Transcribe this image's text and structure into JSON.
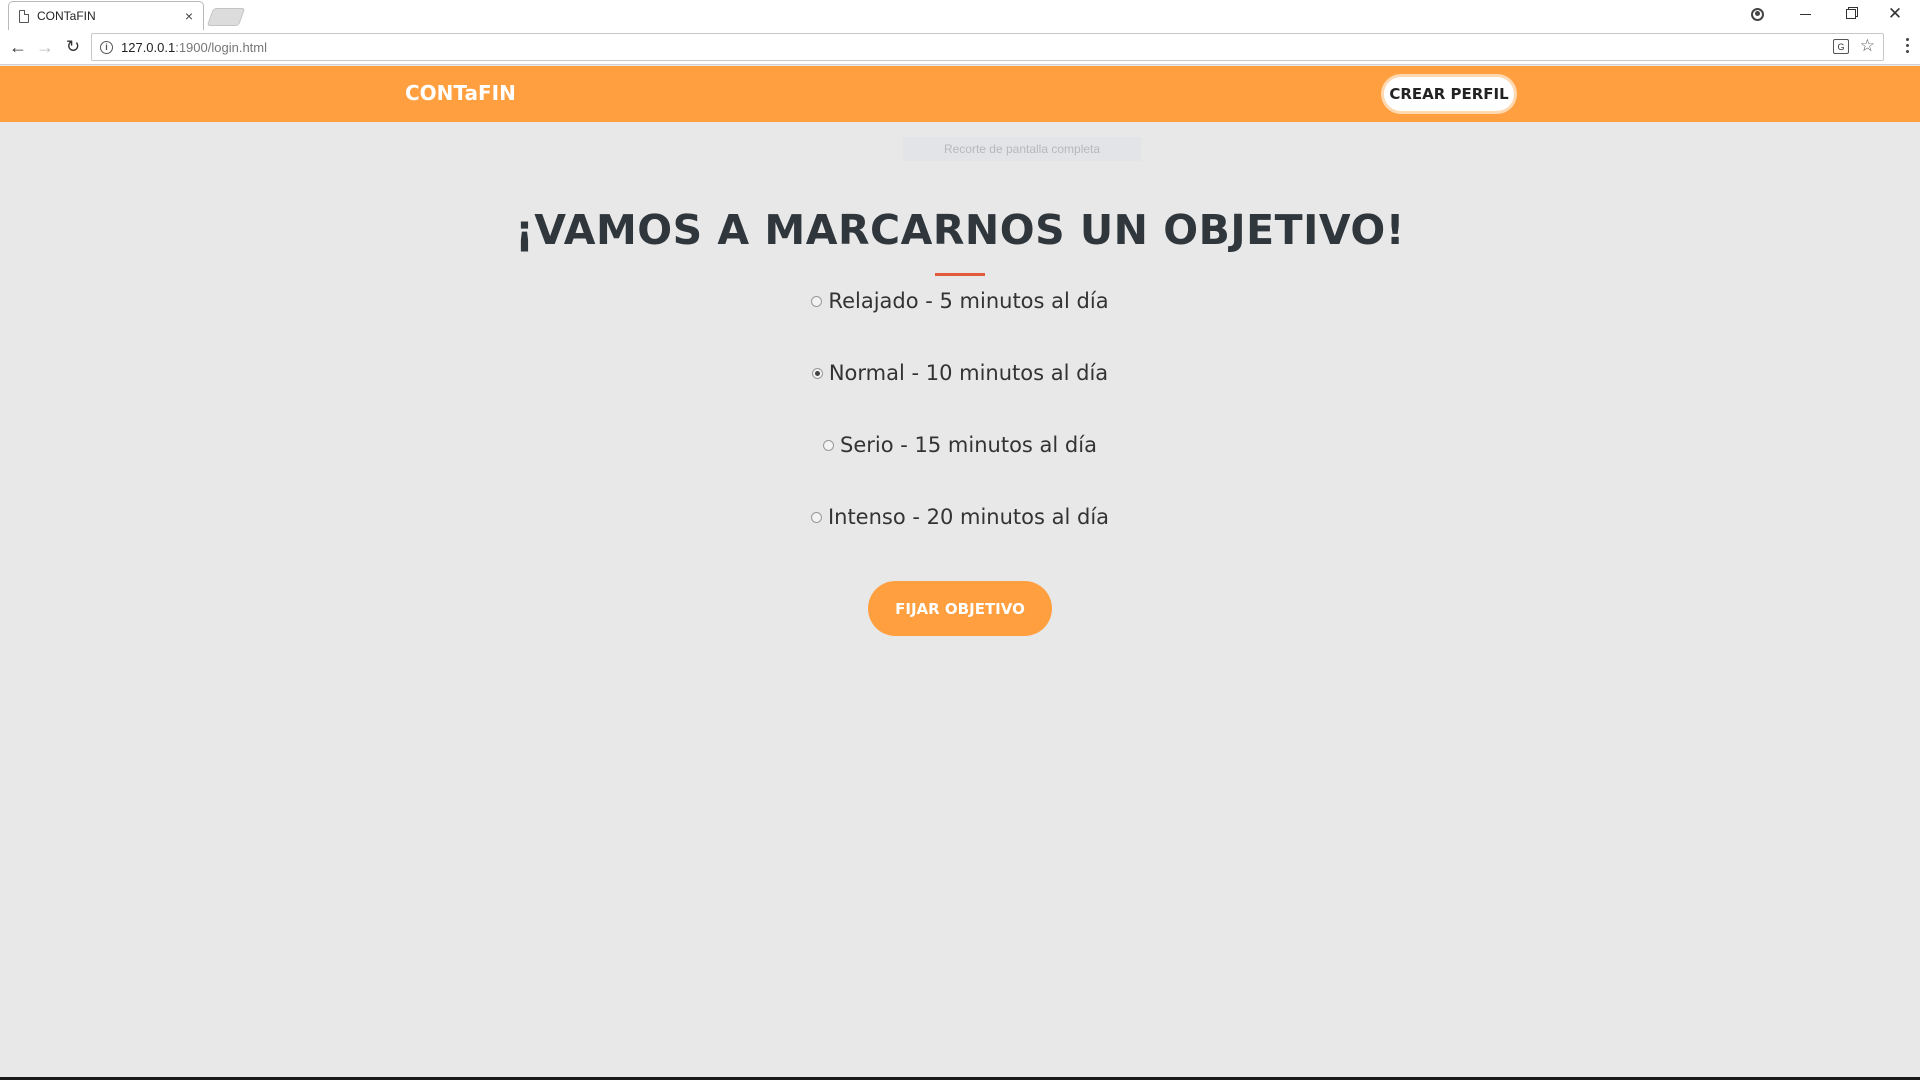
{
  "browser": {
    "tab_title": "CONTaFIN",
    "tab_close": "×",
    "url_host": "127.0.0.1",
    "url_rest": ":1900/login.html",
    "close_glyph": "✕"
  },
  "navbar": {
    "brand": "CONTaFIN",
    "crear_perfil": "CREAR PERFIL"
  },
  "snip_overlay": "Recorte de pantalla completa",
  "main": {
    "heading": "¡VAMOS A MARCARNOS UN OBJETIVO!",
    "options": [
      {
        "label": "Relajado - 5 minutos al día",
        "checked": false
      },
      {
        "label": "Normal - 10 minutos al día",
        "checked": true
      },
      {
        "label": "Serio - 15 minutos al día",
        "checked": false
      },
      {
        "label": "Intenso - 20 minutos al día",
        "checked": false
      }
    ],
    "submit_label": "FIJAR OBJETIVO"
  },
  "colors": {
    "accent": "#ff9f40",
    "divider": "#e35b3c",
    "background": "#e8e8e8",
    "heading": "#2f363c"
  }
}
